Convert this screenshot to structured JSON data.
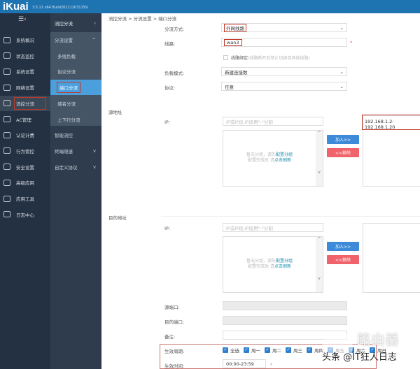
{
  "header": {
    "logo": "iKuai",
    "version": "3.5.11 x64 Build202112031159"
  },
  "sidebar": {
    "items": [
      {
        "label": "系统概况",
        "icon": "dashboard-icon"
      },
      {
        "label": "状态监控",
        "icon": "monitor-icon"
      },
      {
        "label": "系统设置",
        "icon": "gear-icon"
      },
      {
        "label": "网络设置",
        "icon": "network-icon"
      },
      {
        "label": "流控分流",
        "icon": "flow-control-icon",
        "active": true
      },
      {
        "label": "AC管理",
        "icon": "ac-icon"
      },
      {
        "label": "认证计费",
        "icon": "auth-icon"
      },
      {
        "label": "行为管控",
        "icon": "behavior-icon"
      },
      {
        "label": "安全设置",
        "icon": "security-icon"
      },
      {
        "label": "高级应用",
        "icon": "advanced-icon"
      },
      {
        "label": "应用工具",
        "icon": "tools-icon"
      },
      {
        "label": "日志中心",
        "icon": "log-icon"
      }
    ]
  },
  "submenu": {
    "title": "流控分流",
    "items": [
      {
        "label": "分流设置",
        "chev": "^"
      },
      {
        "label": "多线负载",
        "indent": true
      },
      {
        "label": "协议分流",
        "indent": true
      },
      {
        "label": "端口分流",
        "indent": true,
        "active": true
      },
      {
        "label": "域名分流",
        "indent": true
      },
      {
        "label": "上下行分流",
        "indent": true
      },
      {
        "label": "智能流控"
      },
      {
        "label": "终端限速",
        "chev": "v"
      },
      {
        "label": "自定义协议",
        "chev": "v"
      }
    ]
  },
  "breadcrumb": "流控分流 > 分流设置 > 端口分流",
  "form": {
    "mode_label": "分流方式:",
    "mode_value": "外网线路",
    "line_label": "线路:",
    "line_value": "wan3",
    "required": "*",
    "bind_label": "线路绑定",
    "bind_hint": "(线路断开后禁止切换到其他线路)",
    "load_label": "负载模式:",
    "load_value": "新建连接数",
    "proto_label": "协议:",
    "proto_value": "任意",
    "src_title": "源地址",
    "dst_title": "目的地址",
    "ip_label": "IP:",
    "ip_placeholder": "IP或IP段,IP段用\"-\"分割",
    "empty1": "暂无分组，请先",
    "empty_link1": "配置分组",
    "empty2": "配置完成后 请",
    "empty_link2": "点击刷新",
    "add_btn": "加入>>",
    "remove_btn": "<<移除",
    "src_selected": "192.168.1.2-192.168.1.20",
    "sport_label": "源端口:",
    "dport_label": "目的端口:",
    "note_label": "备注:",
    "period_label": "生效周期:",
    "days": [
      "全选",
      "周一",
      "周二",
      "周三",
      "周四",
      "周五",
      "周六",
      "周日"
    ],
    "time_label": "生效时间:",
    "time_value": "00:00-23:59"
  },
  "watermark": {
    "text": "头条 @IT狂人日志",
    "logo": "路由器"
  }
}
